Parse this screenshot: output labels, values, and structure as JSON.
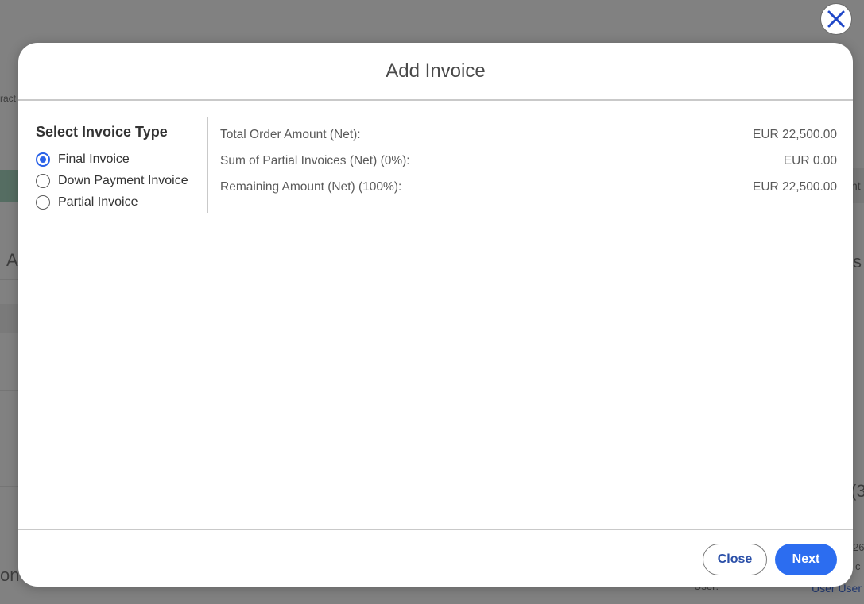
{
  "background": {
    "fragments": [
      "ract",
      "A",
      "nt",
      "s",
      "(3",
      "on",
      "26",
      "c",
      "User:",
      "User User"
    ]
  },
  "dialog": {
    "title": "Add Invoice",
    "close_icon": "close-x-icon",
    "invoice_type": {
      "heading": "Select Invoice Type",
      "selected": "Final Invoice",
      "options": [
        {
          "label": "Final Invoice",
          "checked": true
        },
        {
          "label": "Down Payment Invoice",
          "checked": false
        },
        {
          "label": "Partial Invoice",
          "checked": false
        }
      ]
    },
    "summary": [
      {
        "label": "Total Order Amount (Net):",
        "value": "EUR 22,500.00"
      },
      {
        "label": "Sum of Partial Invoices (Net) (0%):",
        "value": "EUR 0.00"
      },
      {
        "label": "Remaining Amount (Net) (100%):",
        "value": "EUR 22,500.00"
      }
    ],
    "footer": {
      "close_label": "Close",
      "next_label": "Next"
    }
  },
  "colors": {
    "accent": "#2c6df0",
    "radio_checked": "#2a62e8",
    "close_button_text": "#2a4fa8"
  }
}
